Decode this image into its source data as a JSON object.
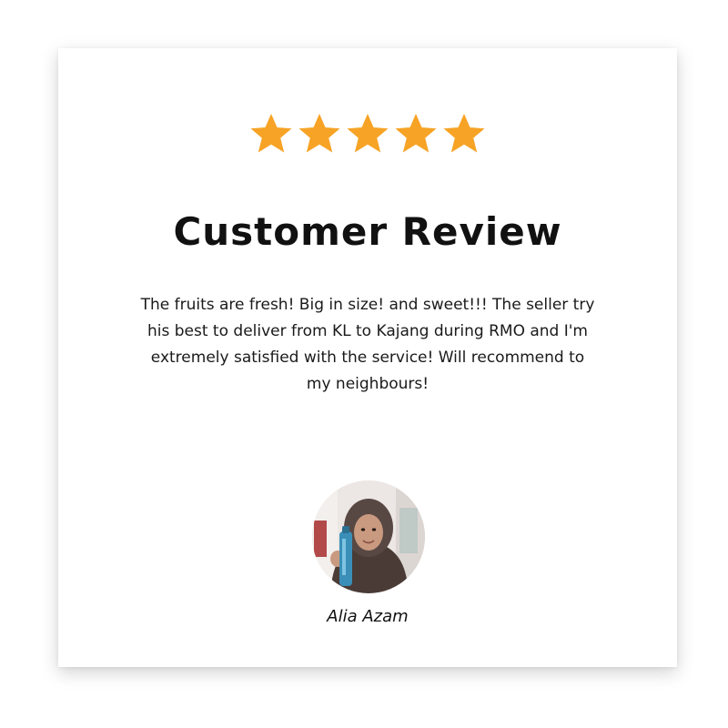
{
  "rating": {
    "value": 5,
    "max": 5,
    "color": "#F7A325"
  },
  "card": {
    "title": "Customer Review",
    "review_text": "The fruits are fresh! Big in size! and sweet!!! The seller try his best to deliver from KL to Kajang during RMO and I'm extremely satisfied with the service! Will recommend to my neighbours!",
    "reviewer_name": "Alia Azam",
    "avatar_icon": "reviewer-photo"
  }
}
